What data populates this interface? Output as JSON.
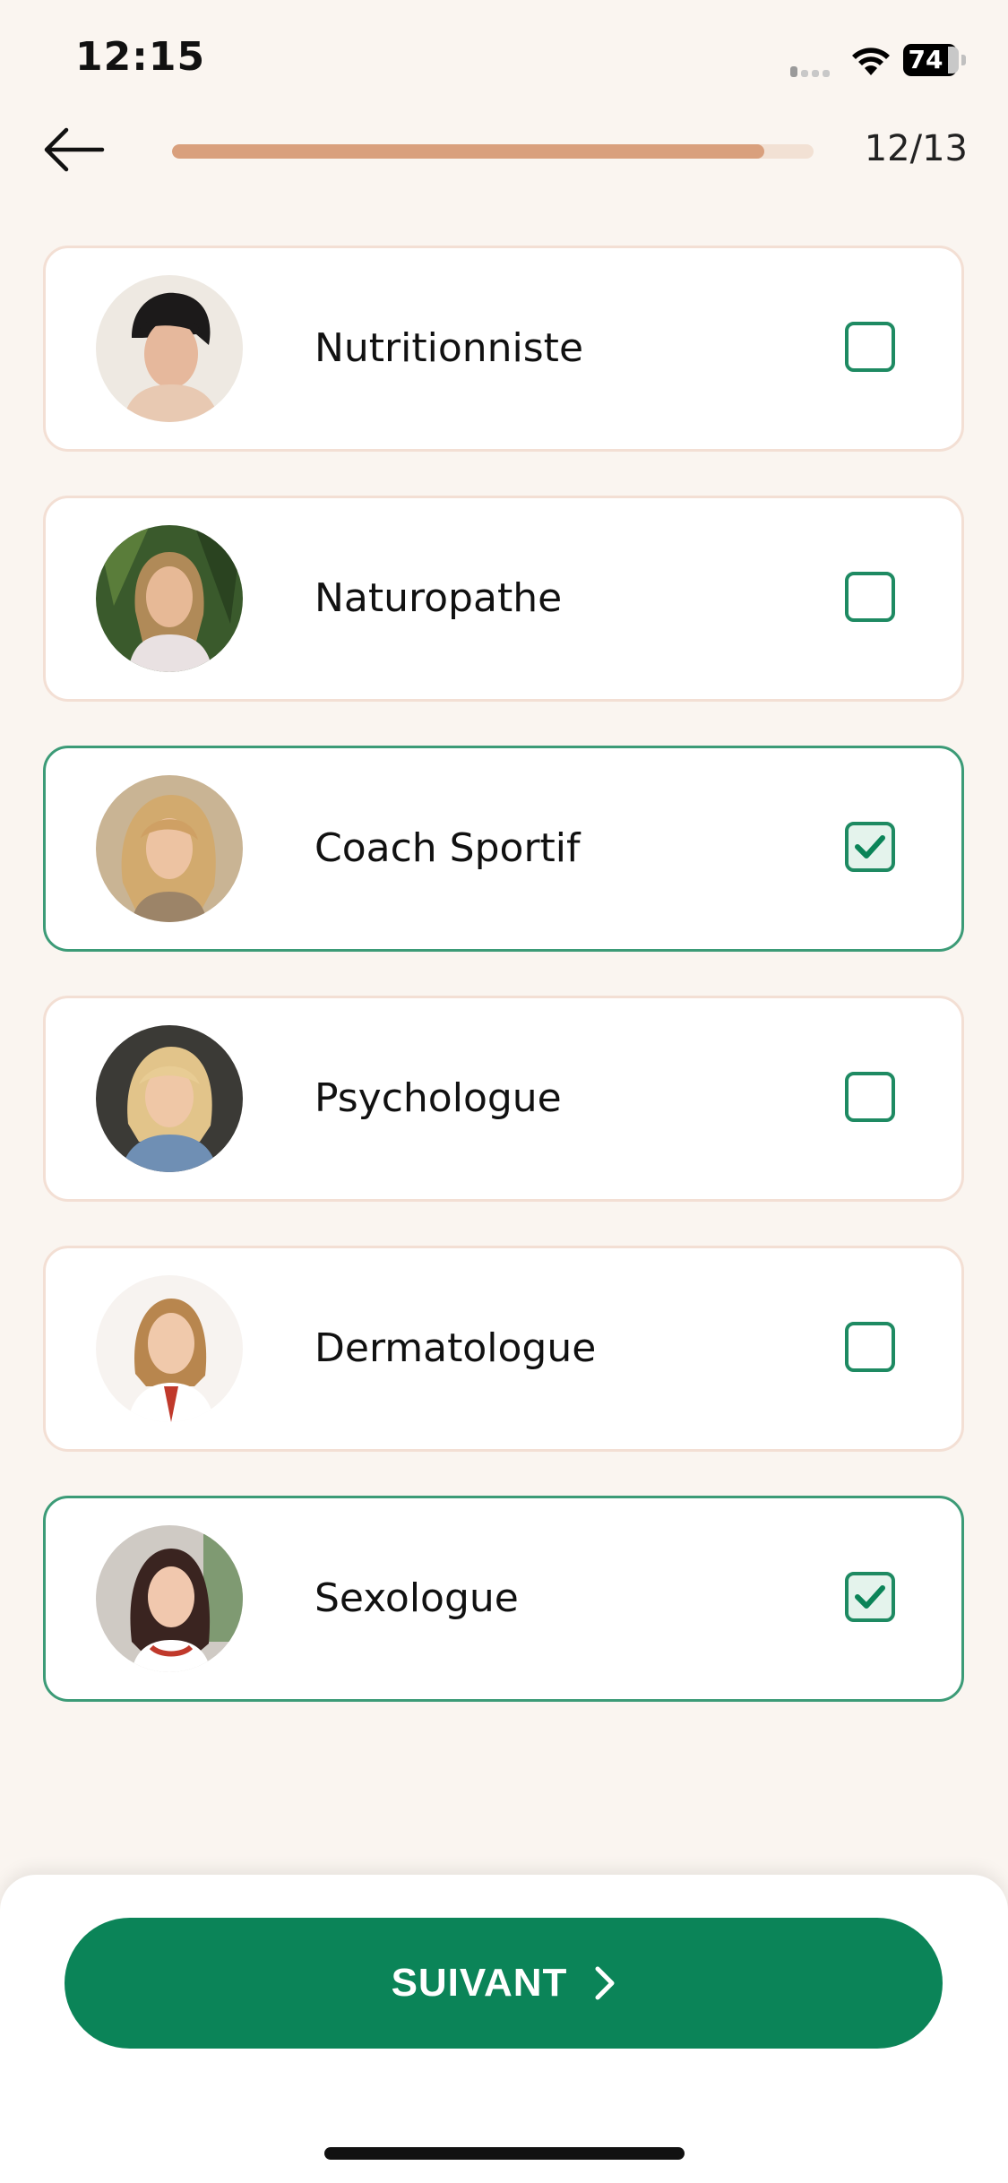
{
  "status_bar": {
    "time": "12:15",
    "battery_level": "74",
    "signal_icon": "cellular-signal-icon",
    "wifi_icon": "wifi-icon",
    "battery_icon": "battery-icon"
  },
  "header": {
    "back_icon": "arrow-left-icon",
    "progress": {
      "current_step": 12,
      "total_steps": 13,
      "fraction": 0.923
    },
    "step_counter": "12/13"
  },
  "options": [
    {
      "label": "Nutritionniste",
      "selected": false,
      "avatar": "avatar-photo"
    },
    {
      "label": "Naturopathe",
      "selected": false,
      "avatar": "avatar-photo"
    },
    {
      "label": "Coach Sportif",
      "selected": true,
      "avatar": "avatar-photo"
    },
    {
      "label": "Psychologue",
      "selected": false,
      "avatar": "avatar-photo"
    },
    {
      "label": "Dermatologue",
      "selected": false,
      "avatar": "avatar-photo"
    },
    {
      "label": "Sexologue",
      "selected": true,
      "avatar": "avatar-photo"
    }
  ],
  "footer": {
    "next_label": "SUIVANT",
    "next_icon": "chevron-right-icon"
  },
  "colors": {
    "background": "#faf5f0",
    "accent_green": "#0b8458",
    "selected_border": "#3c9b77",
    "card_border": "#f3dfd4",
    "progress_fill": "#d9a07d",
    "progress_track": "#f2e1d4"
  }
}
